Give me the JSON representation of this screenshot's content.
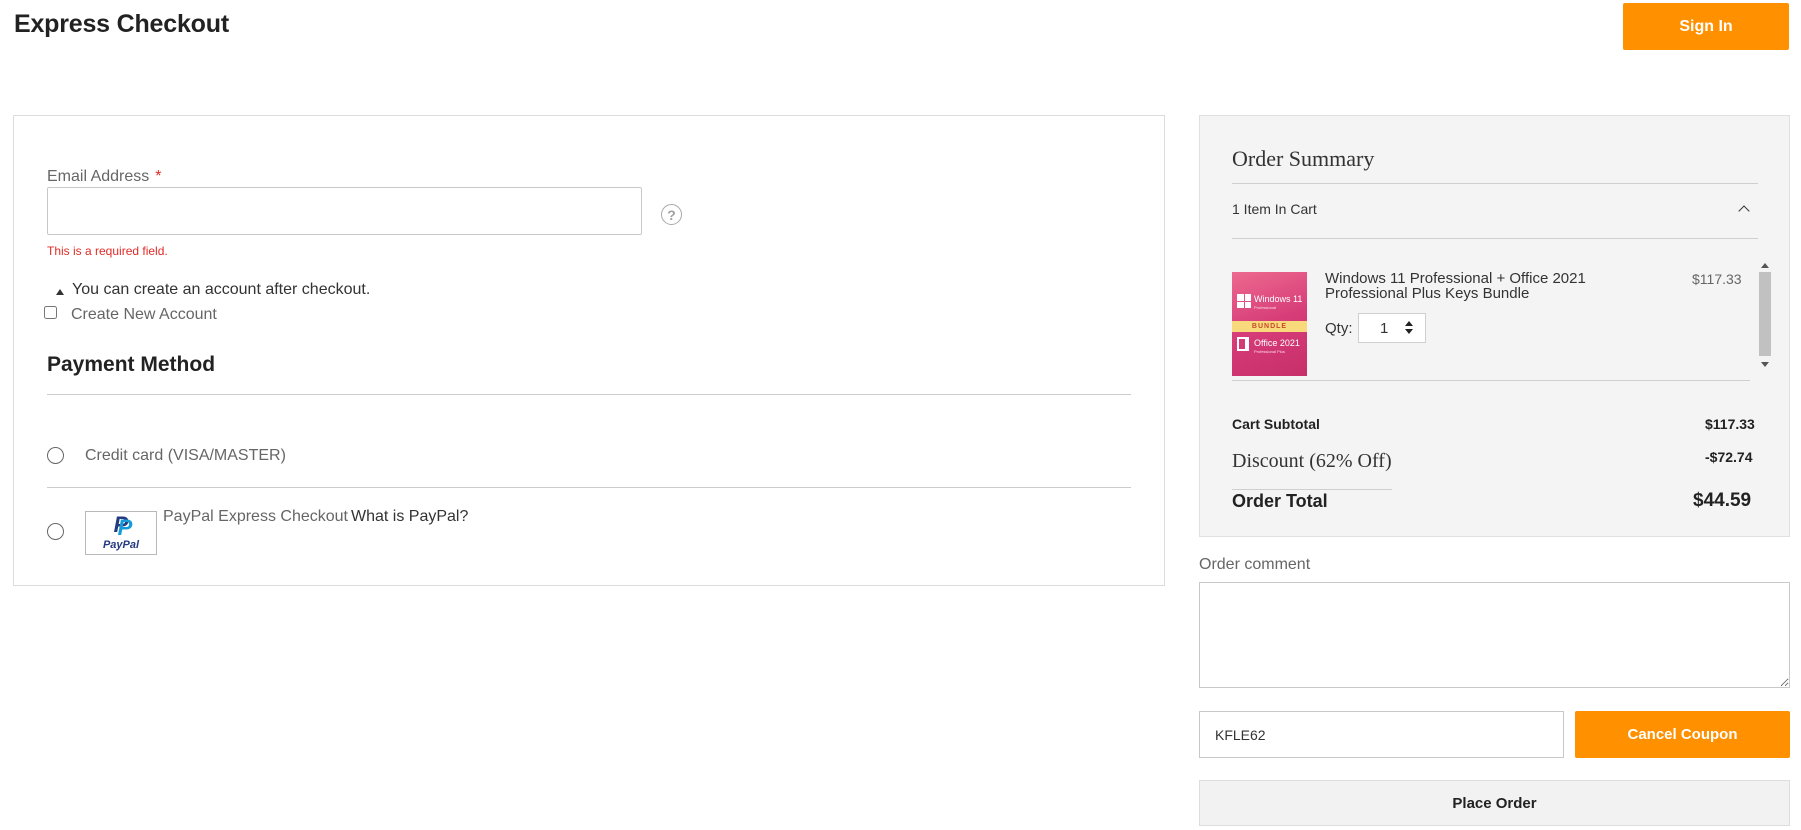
{
  "header": {
    "title": "Express Checkout",
    "sign_in_label": "Sign In"
  },
  "email": {
    "label": "Email Address",
    "required_marker": "*",
    "value": "",
    "error": "This is a required field.",
    "help_icon": "?"
  },
  "account": {
    "note": "You can create an account after checkout.",
    "create_label": "Create New Account",
    "create_checked": false
  },
  "payment": {
    "title": "Payment Method",
    "methods": [
      {
        "label": "Credit card (VISA/MASTER)",
        "selected": false
      },
      {
        "label": "PayPal Express Checkout",
        "link": "What is PayPal?",
        "selected": false
      }
    ],
    "paypal_logo_text": "PayPal"
  },
  "summary": {
    "title": "Order Summary",
    "items_toggle": "1 Item In Cart",
    "item": {
      "name": "Windows 11 Professional + Office 2021 Professional Plus Keys Bundle",
      "price": "$117.33",
      "qty_label": "Qty:",
      "qty": "1",
      "image_text": {
        "windows": "Windows 11",
        "windows_sub": "Professional",
        "bundle": "BUNDLE",
        "office": "Office 2021",
        "office_sub": "Professional Plus"
      }
    },
    "subtotal_label": "Cart Subtotal",
    "subtotal_value": "$117.33",
    "discount_label": "Discount (62% Off)",
    "discount_value": "-$72.74",
    "total_label": "Order Total",
    "total_value": "$44.59"
  },
  "comment": {
    "label": "Order comment",
    "value": ""
  },
  "coupon": {
    "value": "KFLE62",
    "cancel_label": "Cancel Coupon"
  },
  "place_order_label": "Place Order",
  "colors": {
    "accent": "#ff9000",
    "error": "#e02b27",
    "summary_bg": "#f4f4f4"
  }
}
